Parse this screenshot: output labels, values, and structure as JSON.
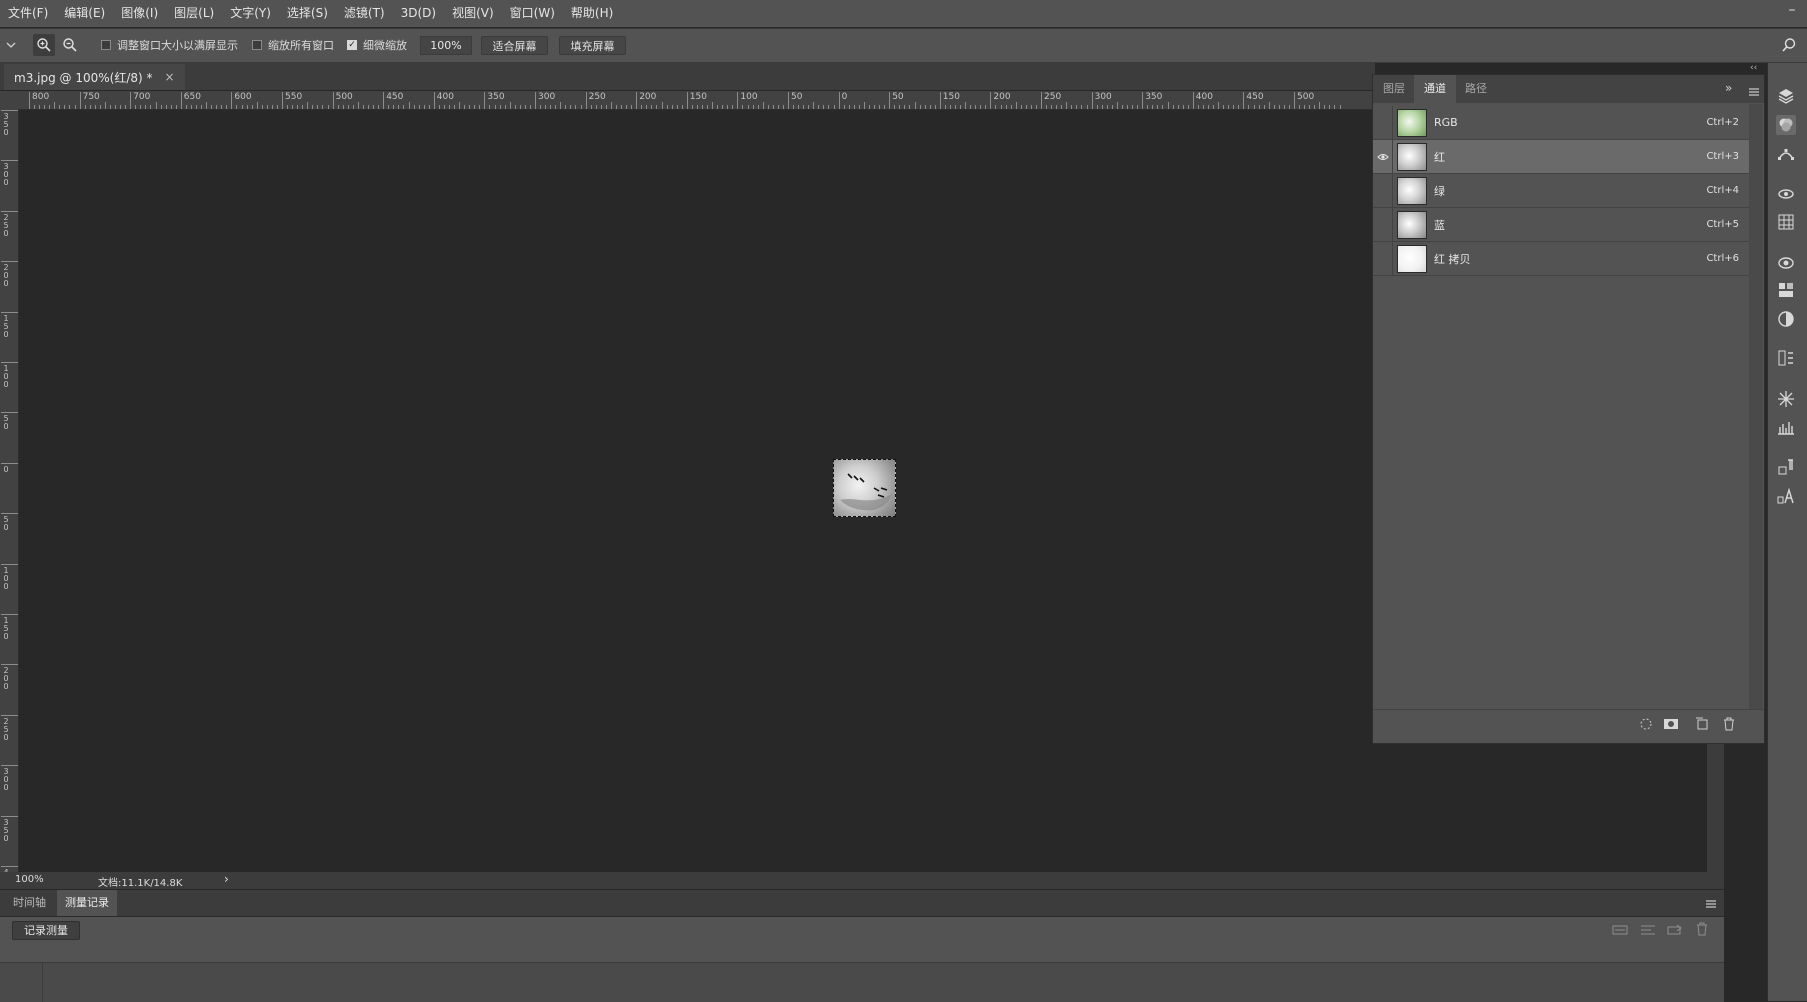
{
  "menu": {
    "items": [
      "文件(F)",
      "编辑(E)",
      "图像(I)",
      "图层(L)",
      "文字(Y)",
      "选择(S)",
      "滤镜(T)",
      "3D(D)",
      "视图(V)",
      "窗口(W)",
      "帮助(H)"
    ]
  },
  "options": {
    "resize_windows_label": "调整窗口大小以满屏显示",
    "zoom_all_label": "缩放所有窗口",
    "scrubby_zoom_label": "细微缩放",
    "zoom_value": "100%",
    "fit_screen_label": "适合屏幕",
    "fill_screen_label": "填充屏幕",
    "scrubby_checked": "✓"
  },
  "document": {
    "tab_title": "m3.jpg @ 100%(红/8) *",
    "close": "×"
  },
  "ruler": {
    "top_labels": [
      "800",
      "750",
      "700",
      "650",
      "600",
      "550",
      "500",
      "450",
      "400",
      "350",
      "300",
      "250",
      "200",
      "150",
      "100",
      "50",
      "0",
      "50",
      "150",
      "200",
      "250",
      "300",
      "350",
      "400",
      "450",
      "500"
    ],
    "left_labels": [
      "350",
      "300",
      "250",
      "200",
      "150",
      "100",
      "50",
      "0",
      "50",
      "100",
      "150",
      "200",
      "250",
      "300",
      "350",
      "4"
    ]
  },
  "status": {
    "zoom": "100%",
    "doc_info": "文档:11.1K/14.8K",
    "arrow": "›"
  },
  "bottom_panel": {
    "tabs": [
      "时间轴",
      "测量记录"
    ],
    "active_tab": 1,
    "record_button": "记录测量"
  },
  "channels_panel": {
    "tabs": [
      "图层",
      "通道",
      "路径"
    ],
    "active_tab": 1,
    "expand": "»",
    "channels": [
      {
        "name": "RGB",
        "shortcut": "Ctrl+2",
        "selected": false,
        "visible": false
      },
      {
        "name": "红",
        "shortcut": "Ctrl+3",
        "selected": true,
        "visible": true
      },
      {
        "name": "绿",
        "shortcut": "Ctrl+4",
        "selected": false,
        "visible": false
      },
      {
        "name": "蓝",
        "shortcut": "Ctrl+5",
        "selected": false,
        "visible": false
      },
      {
        "name": "红 拷贝",
        "shortcut": "Ctrl+6",
        "selected": false,
        "visible": false
      }
    ]
  },
  "colors": {
    "chrome": "#535353",
    "canvas": "#282828",
    "selected_row": "#6a6a6a"
  }
}
